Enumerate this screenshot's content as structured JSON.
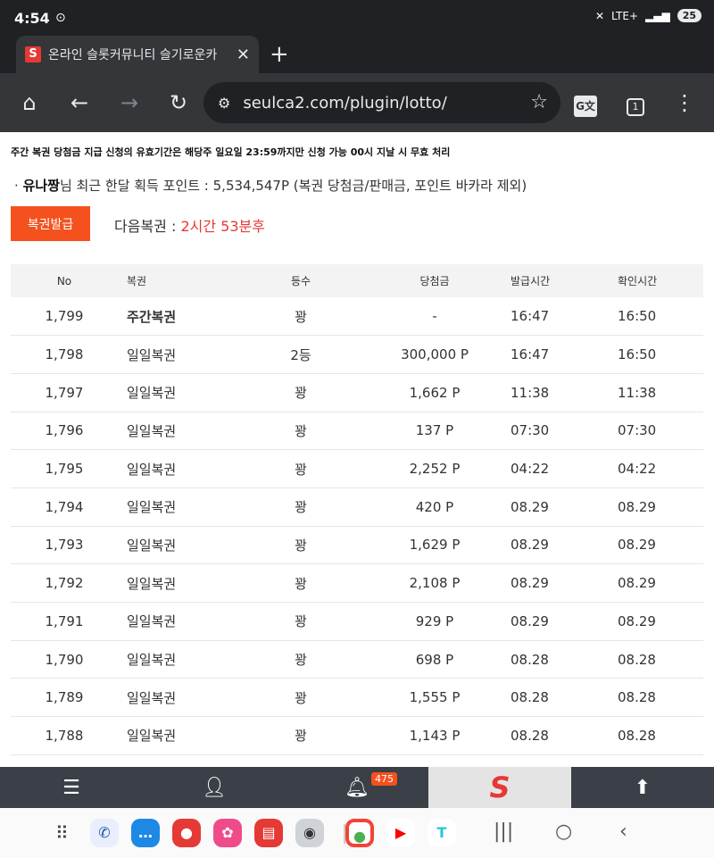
{
  "status_bar": {
    "time": "4:54",
    "network": "LTE+",
    "battery": "25"
  },
  "tab": {
    "title": "온라인 슬롯커뮤니티 슬기로운카",
    "favicon": "S"
  },
  "omnibox": {
    "url": "seulca2.com/plugin/lotto/"
  },
  "toolbar": {
    "tab_count": "1",
    "translate_label": "G文"
  },
  "page": {
    "notice": "주간 복권 당첨금 지급 신청의 유효기간은 해당주 일요일 23:59까지만 신청 가능 00시 지날 시 무효 처리",
    "points_prefix": "·",
    "points_user": "유나짱",
    "points_text": "님 최근 한달 획득 포인트 : 5,534,547P (복권 당첨금/판매금, 포인트 바카라 제외)",
    "issue_button": "복권발급",
    "next_label": "다음복권 : ",
    "next_value": "2시간 53분후"
  },
  "table": {
    "headers": [
      "No",
      "복권",
      "등수",
      "당첨금",
      "발급시간",
      "확인시간"
    ],
    "rows": [
      [
        "1,799",
        "주간복권",
        "꽝",
        "-",
        "16:47",
        "16:50"
      ],
      [
        "1,798",
        "일일복권",
        "2등",
        "300,000 P",
        "16:47",
        "16:50"
      ],
      [
        "1,797",
        "일일복권",
        "꽝",
        "1,662 P",
        "11:38",
        "11:38"
      ],
      [
        "1,796",
        "일일복권",
        "꽝",
        "137 P",
        "07:30",
        "07:30"
      ],
      [
        "1,795",
        "일일복권",
        "꽝",
        "2,252 P",
        "04:22",
        "04:22"
      ],
      [
        "1,794",
        "일일복권",
        "꽝",
        "420 P",
        "08.29",
        "08.29"
      ],
      [
        "1,793",
        "일일복권",
        "꽝",
        "1,629 P",
        "08.29",
        "08.29"
      ],
      [
        "1,792",
        "일일복권",
        "꽝",
        "2,108 P",
        "08.29",
        "08.29"
      ],
      [
        "1,791",
        "일일복권",
        "꽝",
        "929 P",
        "08.29",
        "08.29"
      ],
      [
        "1,790",
        "일일복권",
        "꽝",
        "698 P",
        "08.28",
        "08.28"
      ],
      [
        "1,789",
        "일일복권",
        "꽝",
        "1,555 P",
        "08.28",
        "08.28"
      ],
      [
        "1,788",
        "일일복권",
        "꽝",
        "1,143 P",
        "08.28",
        "08.28"
      ]
    ]
  },
  "site_nav": {
    "notification_count": "475",
    "logo": "S"
  },
  "colors": {
    "accent": "#f4511e",
    "red_text": "#e53935",
    "nav_bg": "#3a3f48"
  }
}
